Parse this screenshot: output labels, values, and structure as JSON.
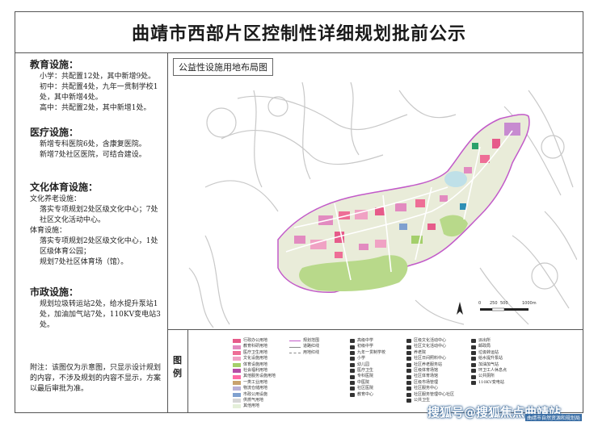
{
  "header": {
    "title": "曲靖市西部片区控制性详细规划批前公示"
  },
  "left_panel": {
    "education": {
      "heading": "教育设施：",
      "primary": "小学：共配置12处，其中新增9处。",
      "middle": "初中：共配置4处，九年一贯制学校1处，其中新增4处。",
      "high": "高中：共配置2处，其中新增1处。"
    },
    "medical": {
      "heading": "医疗设施：",
      "hospital": "新增专科医院6处，含康复医院。",
      "community": "新增7处社区医院，可结合建设。"
    },
    "culture_sports": {
      "heading": "文化体育设施：",
      "culture_sub": "文化养老设施：",
      "culture_text": "落实专项规划2处区级文化中心；7处社区文化活动中心。",
      "sports_sub": "体育设施：",
      "sports_text1": "落实专项规划2处区级文化中心，1处区级体育公园；",
      "sports_text2": "规划7处社区体育场（馆）。"
    },
    "municipal": {
      "heading": "市政设施：",
      "text": "规划垃圾转运站2处，给水提升泵站1处，加油加气站7处，110KV变电站3处。"
    },
    "note": "附注：该图仅为示意图，只显示设计规划的内容，不涉及规划的内容不显示，方案以最后审批为准。"
  },
  "map": {
    "title": "公益性设施用地布局图",
    "scale_labels": [
      "0",
      "250",
      "500",
      "1000m"
    ]
  },
  "legend": {
    "label": "图例",
    "col1": [
      {
        "name": "行政办公用地",
        "color": "#e65b8a"
      },
      {
        "name": "教育科研用地",
        "color": "#e28bc0"
      },
      {
        "name": "医疗卫生用地",
        "color": "#ee6e96"
      },
      {
        "name": "文化设施用地",
        "color": "#f0a2c4"
      },
      {
        "name": "体育设施用地",
        "color": "#a4cf6b"
      },
      {
        "name": "社会福利用地",
        "color": "#b54da6"
      },
      {
        "name": "其他服务设施用地",
        "color": "#ff6aa6"
      },
      {
        "name": "一类工业用地",
        "color": "#c9a26e"
      },
      {
        "name": "物流仓储用地",
        "color": "#b8b0d6"
      },
      {
        "name": "市政公用设施",
        "color": "#7fa0cf"
      },
      {
        "name": "供燃气用地",
        "color": "#d6d6d6"
      },
      {
        "name": "其他用地",
        "color": "#e4efd9"
      }
    ],
    "col2": [
      "规划范围",
      "道路红线",
      "用地红线"
    ],
    "col3": [
      "高级中学",
      "初级中学",
      "九年一贯制学校",
      "小学",
      "幼儿园",
      "医疗卫生",
      "专科医院",
      "中医院",
      "社区医院",
      "教育中心"
    ],
    "col4": [
      "区级文化活动中心",
      "社区文化活动中心",
      "养老院",
      "社区日间照料中心",
      "社区养老服务站",
      "区级体育场馆",
      "社区体育场馆",
      "区级市场管理",
      "社区服务中心",
      "社区服务管理中心社区",
      "公共卫生"
    ],
    "col5": [
      "派出所",
      "邮政局",
      "垃圾转运站",
      "给水提升泵站",
      "加油加气站",
      "环卫工人休息点",
      "公共厕所",
      "110KV变电站"
    ]
  },
  "watermark": {
    "text": "搜狐号@搜狐焦点曲靖站",
    "sub": "曲靖市自然资源和规划局"
  }
}
